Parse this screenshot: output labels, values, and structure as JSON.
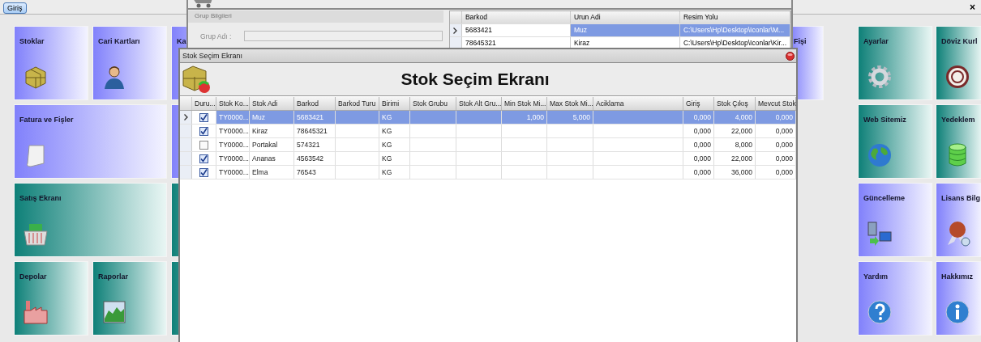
{
  "tab": {
    "label": "Giriş",
    "selected": true
  },
  "close_glyph": "×",
  "left_tiles": [
    {
      "label": "Stoklar"
    },
    {
      "label": "Cari Kartları"
    },
    {
      "label": "Ka"
    },
    {
      "label": "Fatura ve Fişler"
    },
    {
      "label": "Satış Ekranı"
    },
    {
      "label": "Depolar"
    },
    {
      "label": "Raporlar"
    }
  ],
  "middle_tiles": [
    {
      "label": "Fişi"
    }
  ],
  "right_tiles": [
    {
      "label": "Ayarlar"
    },
    {
      "label": "Döviz Kurl"
    },
    {
      "label": "Web Sitemiz"
    },
    {
      "label": "Yedeklem"
    },
    {
      "label": "Güncelleme"
    },
    {
      "label": "Lisans Bilg"
    },
    {
      "label": "Yardım"
    },
    {
      "label": "Hakkımız"
    }
  ],
  "back_window": {
    "group_panel": {
      "title": "Grup Bilgileri",
      "field_label": "Grup Adı :"
    },
    "grid": {
      "columns": [
        "Barkod",
        "Urun Adi",
        "Resim Yolu"
      ],
      "rows": [
        {
          "selected": true,
          "cells": [
            "5683421",
            "Muz",
            "C:\\Users\\Hp\\Desktop\\Iconlar\\M..."
          ]
        },
        {
          "selected": false,
          "cells": [
            "78645321",
            "Kiraz",
            "C:\\Users\\Hp\\Desktop\\Iconlar\\Kir..."
          ]
        }
      ]
    }
  },
  "stock_window": {
    "title": "Stok Seçim Ekranı",
    "heading": "Stok Seçim Ekranı",
    "columns": [
      "Duru...",
      "Stok Ko...",
      "Stok Adi",
      "Barkod",
      "Barkod Turu",
      "Birimi",
      "Stok Grubu",
      "Stok Alt Gru...",
      "Min Stok Mi...",
      "Max Stok Mi...",
      "Aciklama",
      "Giriş",
      "Stok Çıkış",
      "Mevcut Stok"
    ],
    "rows": [
      {
        "selected": true,
        "checked": true,
        "code": "TY0000...",
        "name": "Muz",
        "barcode": "5683421",
        "unit": "KG",
        "min_stock": "1,000",
        "max_stock": "5,000",
        "in": "0,000",
        "out": "4,000",
        "balance": "0,000"
      },
      {
        "selected": false,
        "checked": true,
        "code": "TY0000...",
        "name": "Kiraz",
        "barcode": "78645321",
        "unit": "KG",
        "in": "0,000",
        "out": "22,000",
        "balance": "0,000"
      },
      {
        "selected": false,
        "checked": false,
        "code": "TY0000...",
        "name": "Portakal",
        "barcode": "574321",
        "unit": "KG",
        "in": "0,000",
        "out": "8,000",
        "balance": "0,000"
      },
      {
        "selected": false,
        "checked": true,
        "code": "TY0000...",
        "name": "Ananas",
        "barcode": "4563542",
        "unit": "KG",
        "in": "0,000",
        "out": "22,000",
        "balance": "0,000"
      },
      {
        "selected": false,
        "checked": true,
        "code": "TY0000...",
        "name": "Elma",
        "barcode": "76543",
        "unit": "KG",
        "in": "0,000",
        "out": "36,000",
        "balance": "0,000"
      }
    ]
  }
}
